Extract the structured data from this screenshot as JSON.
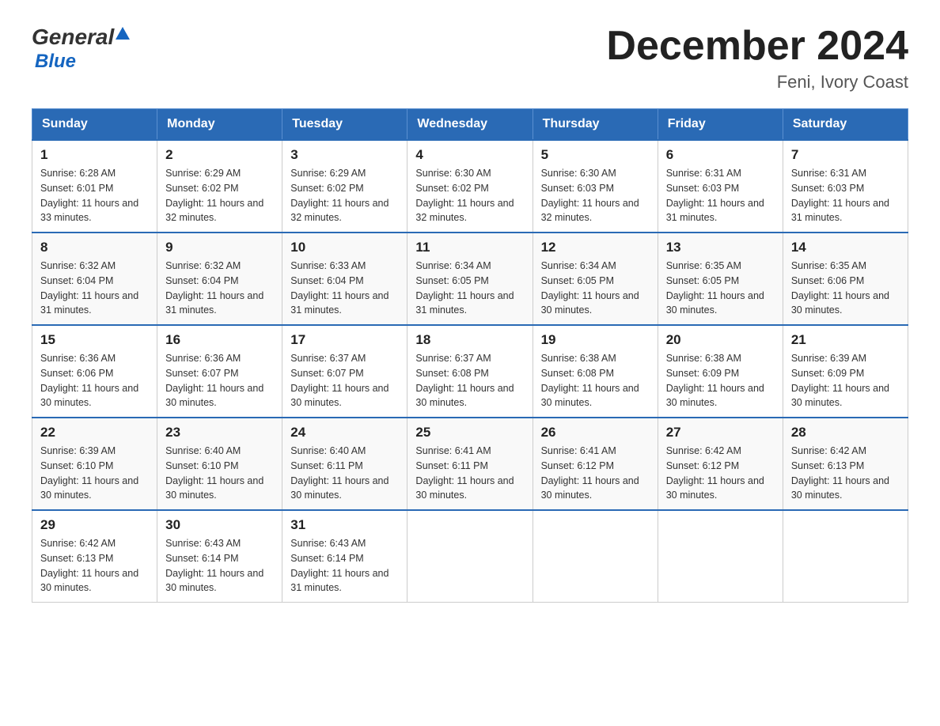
{
  "header": {
    "logo_general": "General",
    "logo_blue": "Blue",
    "month_year": "December 2024",
    "location": "Feni, Ivory Coast"
  },
  "days_of_week": [
    "Sunday",
    "Monday",
    "Tuesday",
    "Wednesday",
    "Thursday",
    "Friday",
    "Saturday"
  ],
  "weeks": [
    [
      {
        "day": "1",
        "sunrise": "6:28 AM",
        "sunset": "6:01 PM",
        "daylight": "11 hours and 33 minutes."
      },
      {
        "day": "2",
        "sunrise": "6:29 AM",
        "sunset": "6:02 PM",
        "daylight": "11 hours and 32 minutes."
      },
      {
        "day": "3",
        "sunrise": "6:29 AM",
        "sunset": "6:02 PM",
        "daylight": "11 hours and 32 minutes."
      },
      {
        "day": "4",
        "sunrise": "6:30 AM",
        "sunset": "6:02 PM",
        "daylight": "11 hours and 32 minutes."
      },
      {
        "day": "5",
        "sunrise": "6:30 AM",
        "sunset": "6:03 PM",
        "daylight": "11 hours and 32 minutes."
      },
      {
        "day": "6",
        "sunrise": "6:31 AM",
        "sunset": "6:03 PM",
        "daylight": "11 hours and 31 minutes."
      },
      {
        "day": "7",
        "sunrise": "6:31 AM",
        "sunset": "6:03 PM",
        "daylight": "11 hours and 31 minutes."
      }
    ],
    [
      {
        "day": "8",
        "sunrise": "6:32 AM",
        "sunset": "6:04 PM",
        "daylight": "11 hours and 31 minutes."
      },
      {
        "day": "9",
        "sunrise": "6:32 AM",
        "sunset": "6:04 PM",
        "daylight": "11 hours and 31 minutes."
      },
      {
        "day": "10",
        "sunrise": "6:33 AM",
        "sunset": "6:04 PM",
        "daylight": "11 hours and 31 minutes."
      },
      {
        "day": "11",
        "sunrise": "6:34 AM",
        "sunset": "6:05 PM",
        "daylight": "11 hours and 31 minutes."
      },
      {
        "day": "12",
        "sunrise": "6:34 AM",
        "sunset": "6:05 PM",
        "daylight": "11 hours and 30 minutes."
      },
      {
        "day": "13",
        "sunrise": "6:35 AM",
        "sunset": "6:05 PM",
        "daylight": "11 hours and 30 minutes."
      },
      {
        "day": "14",
        "sunrise": "6:35 AM",
        "sunset": "6:06 PM",
        "daylight": "11 hours and 30 minutes."
      }
    ],
    [
      {
        "day": "15",
        "sunrise": "6:36 AM",
        "sunset": "6:06 PM",
        "daylight": "11 hours and 30 minutes."
      },
      {
        "day": "16",
        "sunrise": "6:36 AM",
        "sunset": "6:07 PM",
        "daylight": "11 hours and 30 minutes."
      },
      {
        "day": "17",
        "sunrise": "6:37 AM",
        "sunset": "6:07 PM",
        "daylight": "11 hours and 30 minutes."
      },
      {
        "day": "18",
        "sunrise": "6:37 AM",
        "sunset": "6:08 PM",
        "daylight": "11 hours and 30 minutes."
      },
      {
        "day": "19",
        "sunrise": "6:38 AM",
        "sunset": "6:08 PM",
        "daylight": "11 hours and 30 minutes."
      },
      {
        "day": "20",
        "sunrise": "6:38 AM",
        "sunset": "6:09 PM",
        "daylight": "11 hours and 30 minutes."
      },
      {
        "day": "21",
        "sunrise": "6:39 AM",
        "sunset": "6:09 PM",
        "daylight": "11 hours and 30 minutes."
      }
    ],
    [
      {
        "day": "22",
        "sunrise": "6:39 AM",
        "sunset": "6:10 PM",
        "daylight": "11 hours and 30 minutes."
      },
      {
        "day": "23",
        "sunrise": "6:40 AM",
        "sunset": "6:10 PM",
        "daylight": "11 hours and 30 minutes."
      },
      {
        "day": "24",
        "sunrise": "6:40 AM",
        "sunset": "6:11 PM",
        "daylight": "11 hours and 30 minutes."
      },
      {
        "day": "25",
        "sunrise": "6:41 AM",
        "sunset": "6:11 PM",
        "daylight": "11 hours and 30 minutes."
      },
      {
        "day": "26",
        "sunrise": "6:41 AM",
        "sunset": "6:12 PM",
        "daylight": "11 hours and 30 minutes."
      },
      {
        "day": "27",
        "sunrise": "6:42 AM",
        "sunset": "6:12 PM",
        "daylight": "11 hours and 30 minutes."
      },
      {
        "day": "28",
        "sunrise": "6:42 AM",
        "sunset": "6:13 PM",
        "daylight": "11 hours and 30 minutes."
      }
    ],
    [
      {
        "day": "29",
        "sunrise": "6:42 AM",
        "sunset": "6:13 PM",
        "daylight": "11 hours and 30 minutes."
      },
      {
        "day": "30",
        "sunrise": "6:43 AM",
        "sunset": "6:14 PM",
        "daylight": "11 hours and 30 minutes."
      },
      {
        "day": "31",
        "sunrise": "6:43 AM",
        "sunset": "6:14 PM",
        "daylight": "11 hours and 31 minutes."
      },
      null,
      null,
      null,
      null
    ]
  ]
}
